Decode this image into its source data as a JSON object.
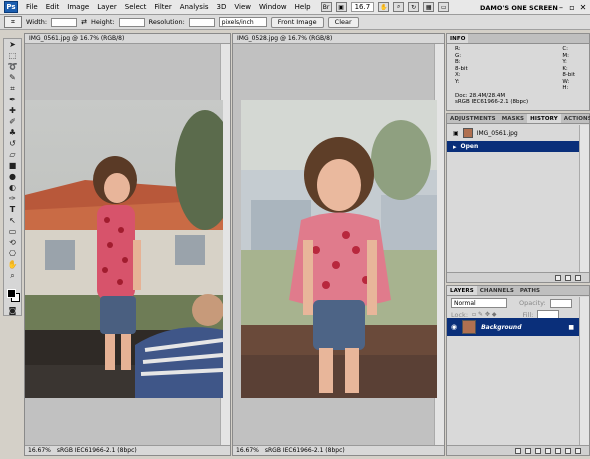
{
  "menubar": {
    "logo": "Ps",
    "items": [
      "File",
      "Edit",
      "Image",
      "Layer",
      "Select",
      "Filter",
      "Analysis",
      "3D",
      "View",
      "Window",
      "Help"
    ],
    "zoom": "16.7",
    "workspace": "DAMO'S ONE SCREEN"
  },
  "options": {
    "width_label": "Width:",
    "height_label": "Height:",
    "resolution_label": "Resolution:",
    "resolution_unit": "pixels/inch",
    "front_image_label": "Front Image",
    "clear_label": "Clear"
  },
  "doc_left": {
    "title": "IMG_0561.jpg @ 16.7% (RGB/8)",
    "zoom": "16.67%",
    "profile": "sRGB IEC61966-2.1 (8bpc)"
  },
  "doc_right": {
    "title": "IMG_0528.jpg @ 16.7% (RGB/8)",
    "zoom": "16.67%",
    "profile": "sRGB IEC61966-2.1 (8bpc)"
  },
  "info_panel": {
    "tab": "INFO",
    "rows_left": [
      "R:",
      "G:",
      "B:",
      "8-bit",
      "X:",
      "Y:"
    ],
    "rows_right": [
      "C:",
      "M:",
      "Y:",
      "K:",
      "8-bit",
      "W:",
      "H:"
    ],
    "doc_line": "Doc: 28.4M/28.4M",
    "profile_line": "sRGB IEC61966-2.1 (8bpc)"
  },
  "history_panel": {
    "tabs": [
      "ADJUSTMENTS",
      "MASKS",
      "HISTORY",
      "ACTIONS"
    ],
    "snapshot": "IMG_0561.jpg",
    "state": "Open"
  },
  "layers_panel": {
    "tabs": [
      "LAYERS",
      "CHANNELS",
      "PATHS"
    ],
    "blend_mode": "Normal",
    "opacity_label": "Opacity:",
    "fill_label": "Fill:",
    "lock_label": "Lock:",
    "layer_name": "Background"
  }
}
